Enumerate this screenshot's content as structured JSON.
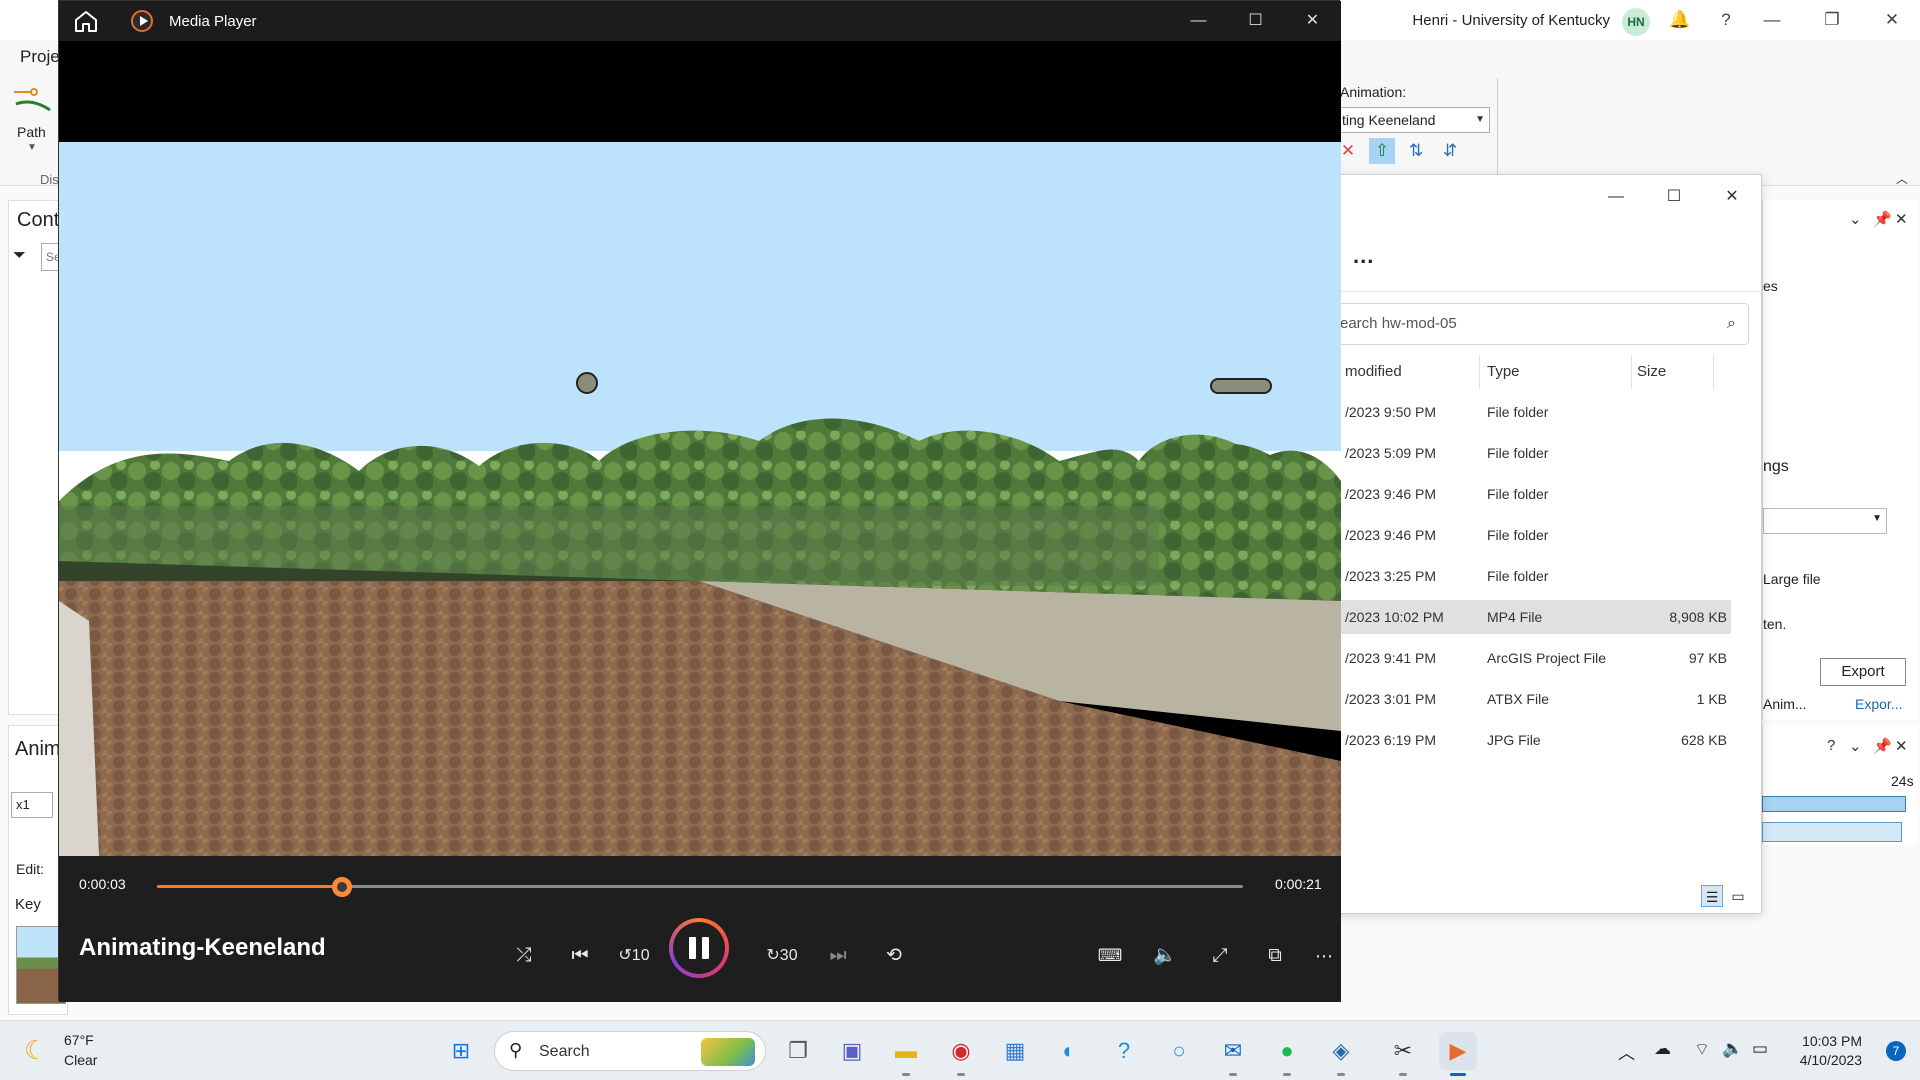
{
  "arcgis": {
    "user": "Henri - University of Kentucky",
    "avatar_initials": "HN",
    "ribbon_tab": "Proje",
    "path_label": "Path",
    "dis_label": "Dis",
    "animation_label": "Animation:",
    "animation_value": "ting Keeneland",
    "contents_title": "Cont",
    "contents_search": "Se",
    "animation_panel_title": "Anim",
    "speed_value": "x1",
    "edit_label": "Edit:",
    "key_label": "Key",
    "right_pane": {
      "text_es": "es",
      "text_ngs": "ngs",
      "large_file": "Large file",
      "ten": "ten.",
      "export_button": "Export",
      "tab_anim": "Anim...",
      "tab_export": "Expor...",
      "timeline_end": "24s"
    }
  },
  "explorer": {
    "more_label": "...",
    "search_placeholder": "earch hw-mod-05",
    "columns": {
      "modified": "modified",
      "type": "Type",
      "size": "Size"
    },
    "rows": [
      {
        "modified": "/2023 9:50 PM",
        "type": "File folder",
        "size": ""
      },
      {
        "modified": "/2023 5:09 PM",
        "type": "File folder",
        "size": ""
      },
      {
        "modified": "/2023 9:46 PM",
        "type": "File folder",
        "size": ""
      },
      {
        "modified": "/2023 9:46 PM",
        "type": "File folder",
        "size": ""
      },
      {
        "modified": "/2023 3:25 PM",
        "type": "File folder",
        "size": ""
      },
      {
        "modified": "/2023 10:02 PM",
        "type": "MP4 File",
        "size": "8,908 KB"
      },
      {
        "modified": "/2023 9:41 PM",
        "type": "ArcGIS Project File",
        "size": "97 KB"
      },
      {
        "modified": "/2023 3:01 PM",
        "type": "ATBX File",
        "size": "1 KB"
      },
      {
        "modified": "/2023 6:19 PM",
        "type": "JPG File",
        "size": "628 KB"
      }
    ]
  },
  "player": {
    "app_title": "Media Player",
    "video_title": "Animating-Keeneland",
    "elapsed": "0:00:03",
    "total": "0:00:21",
    "progress_fraction": 0.17,
    "accent": "#ff7a28"
  },
  "taskbar": {
    "temperature": "67°F",
    "condition": "Clear",
    "search_label": "Search",
    "time": "10:03 PM",
    "date": "4/10/2023",
    "notification_count": "7",
    "apps": [
      "start-icon",
      "task-view-icon",
      "teams-icon",
      "file-explorer-icon",
      "vivaldi-icon",
      "store-icon",
      "edge-icon",
      "help-icon",
      "cortana-icon",
      "outlook-icon",
      "spotify-icon",
      "vpn-icon",
      "snipping-tool-icon",
      "media-player-icon"
    ]
  }
}
